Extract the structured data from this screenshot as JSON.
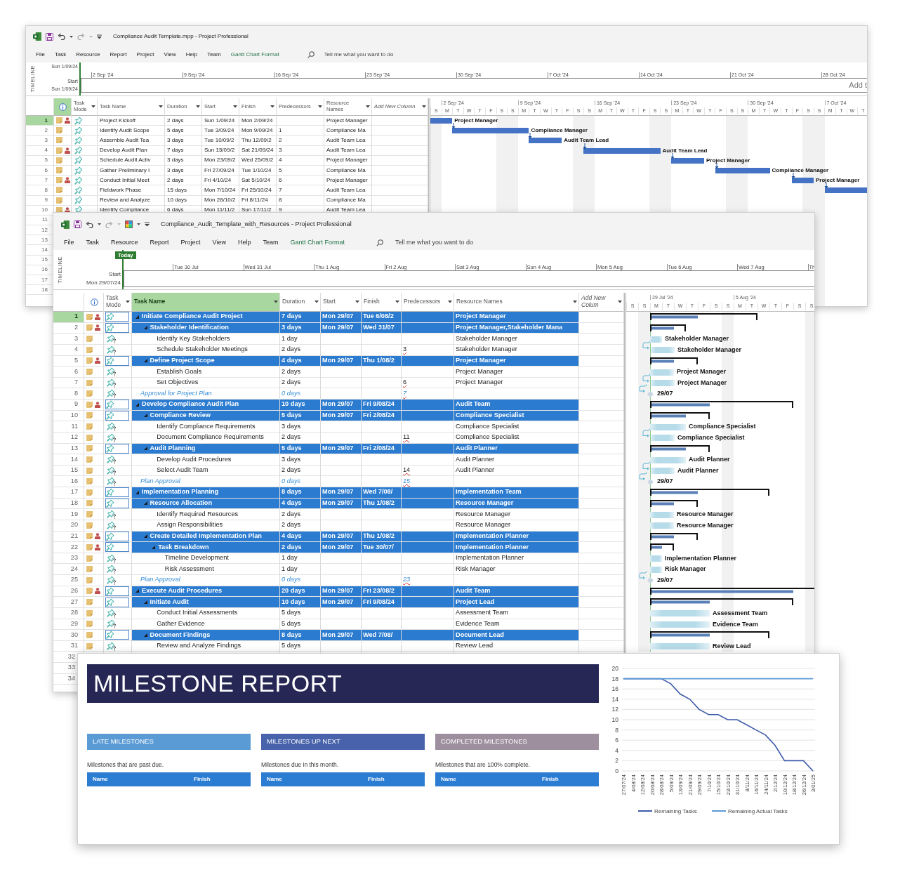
{
  "back_window": {
    "title": "Compliance Audit Template.mpp - Project Professional",
    "menu": [
      {
        "label": "File",
        "contextual": false
      },
      {
        "label": "Task",
        "contextual": false
      },
      {
        "label": "Resource",
        "contextual": false
      },
      {
        "label": "Report",
        "contextual": false
      },
      {
        "label": "Project",
        "contextual": false
      },
      {
        "label": "View",
        "contextual": false
      },
      {
        "label": "Help",
        "contextual": false
      },
      {
        "label": "Team",
        "contextual": false
      },
      {
        "label": "Gantt Chart Format",
        "contextual": true
      }
    ],
    "search": {
      "placeholder": "Tell me what you want to do"
    },
    "timeline": {
      "label": "TIMELINE",
      "top_date": "Sun 1/09/24",
      "start_label": "Start",
      "start_date": "Sun 1/09/24",
      "ticks": [
        "2 Sep '24",
        "9 Sep '24",
        "16 Sep '24",
        "23 Sep '24",
        "30 Sep '24",
        "7 Oct '24",
        "14 Oct '24",
        "21 Oct '24",
        "28 Oct '24"
      ],
      "hint": "Add t"
    },
    "indicator_header_selected": true,
    "columns": [
      {
        "label": "Task Mode",
        "selected": false
      },
      {
        "label": "Task Name",
        "selected": false
      },
      {
        "label": "Duration",
        "selected": false
      },
      {
        "label": "Start",
        "selected": false
      },
      {
        "label": "Finish",
        "selected": false
      },
      {
        "label": "Predecessors",
        "selected": false
      },
      {
        "label": "Resource Names",
        "selected": false
      },
      {
        "label": "Add New Column",
        "selected": false
      }
    ],
    "gantt": {
      "weeks": [
        "2 Sep '24",
        "9 Sep '24",
        "16 Sep '24",
        "23 Sep '24",
        "30 Sep '24",
        "7 Oct '24"
      ],
      "days": [
        "S",
        "M",
        "T",
        "W",
        "T",
        "F",
        "S",
        "S",
        "M",
        "T",
        "W",
        "T",
        "F",
        "S",
        "S",
        "M",
        "T",
        "W",
        "T",
        "F",
        "S",
        "S",
        "M",
        "T",
        "W",
        "T",
        "F",
        "S",
        "S",
        "M",
        "T",
        "W",
        "T",
        "F",
        "S",
        "S",
        "M",
        "T",
        "W",
        "T"
      ]
    },
    "rows": [
      {
        "number": "1",
        "selected": true,
        "resource_indicator": true,
        "name": "Project Kickoff",
        "duration": "2 days",
        "start": "Sun 1/09/24",
        "finish": "Mon 2/09/24",
        "resource": "Project Manager",
        "bar_label": "Project Manager"
      },
      {
        "number": "2",
        "selected": false,
        "resource_indicator": false,
        "name": "Identify Audit Scope",
        "duration": "5 days",
        "start": "Tue 3/09/24",
        "finish": "Mon 9/09/24",
        "predecessors": "1",
        "resource": "Compliance Ma",
        "bar_label": "Compliance Manager"
      },
      {
        "number": "3",
        "selected": false,
        "resource_indicator": false,
        "name": "Assemble Audit Tea",
        "duration": "3 days",
        "start": "Tue 10/09/2",
        "finish": "Thu 12/09/2",
        "predecessors": "2",
        "resource": "Audit Team Lea",
        "bar_label": "Audit Team Lead"
      },
      {
        "number": "4",
        "selected": false,
        "resource_indicator": true,
        "name": "Develop Audit Plan",
        "duration": "7 days",
        "start": "Sun 15/09/2",
        "finish": "Sat 21/09/24",
        "predecessors": "3",
        "resource": "Audit Team Lea",
        "bar_label": "Audit Team Lead"
      },
      {
        "number": "5",
        "selected": false,
        "resource_indicator": false,
        "name": "Schedule Audit Activ",
        "duration": "3 days",
        "start": "Mon 23/09/2",
        "finish": "Wed 25/09/2",
        "predecessors": "4",
        "resource": "Project Manager",
        "bar_label": "Project Manager"
      },
      {
        "number": "6",
        "selected": false,
        "resource_indicator": false,
        "name": "Gather Preliminary I",
        "duration": "3 days",
        "start": "Fri 27/09/24",
        "finish": "Tue 1/10/24",
        "predecessors": "5",
        "resource": "Compliance Ma",
        "bar_label": "Compliance Manager"
      },
      {
        "number": "7",
        "selected": false,
        "resource_indicator": true,
        "name": "Conduct Initial Meet",
        "duration": "2 days",
        "start": "Fri 4/10/24",
        "finish": "Sat 5/10/24",
        "predecessors": "6",
        "resource": "Project Manager",
        "bar_label": "Project Manager"
      },
      {
        "number": "8",
        "selected": false,
        "resource_indicator": false,
        "name": "Fieldwork Phase",
        "duration": "15 days",
        "start": "Mon 7/10/24",
        "finish": "Fri 25/10/24",
        "predecessors": "7",
        "resource": "Audit Team Lea"
      },
      {
        "number": "9",
        "selected": false,
        "resource_indicator": false,
        "name": "Review and Analyze",
        "duration": "10 days",
        "start": "Mon 28/10/2",
        "finish": "Fri 8/11/24",
        "predecessors": "8",
        "resource": "Compliance Ma"
      },
      {
        "number": "10",
        "selected": false,
        "resource_indicator": true,
        "name": "Identify Compliance",
        "duration": "6 days",
        "start": "Mon 11/11/2",
        "finish": "Sun 17/11/2",
        "predecessors": "9",
        "resource": "Audit Team Lea"
      }
    ],
    "more_row_numbers": [
      "11",
      "12",
      "13",
      "14",
      "15",
      "16",
      "17",
      "18"
    ]
  },
  "front_window": {
    "title": "Compliance_Audit_Template_with_Resources - Project Professional",
    "menu": [
      {
        "label": "File",
        "contextual": false
      },
      {
        "label": "Task",
        "contextual": false
      },
      {
        "label": "Resource",
        "contextual": false
      },
      {
        "label": "Report",
        "contextual": false
      },
      {
        "label": "Project",
        "contextual": false
      },
      {
        "label": "View",
        "contextual": false
      },
      {
        "label": "Help",
        "contextual": false
      },
      {
        "label": "Team",
        "contextual": false
      },
      {
        "label": "Gantt Chart Format",
        "contextual": true
      }
    ],
    "search": {
      "placeholder": "Tell me what you want to do"
    },
    "timeline": {
      "label": "TIMELINE",
      "today": "Today",
      "start_label": "Start",
      "start_date": "Mon 29/07/24",
      "ticks": [
        "Tue 30 Jul",
        "Wed 31 Jul",
        "Thu 1 Aug",
        "Fri 2 Aug",
        "Sat 3 Aug",
        "Sun 4 Aug",
        "Mon 5 Aug",
        "Tue 6 Aug",
        "Wed 7 Aug",
        "Th"
      ]
    },
    "columns": [
      {
        "label": "Task Mode",
        "selected": false
      },
      {
        "label": "Task Name",
        "selected": true
      },
      {
        "label": "Duration",
        "selected": false
      },
      {
        "label": "Start",
        "selected": false
      },
      {
        "label": "Finish",
        "selected": false
      },
      {
        "label": "Predecessors",
        "selected": false
      },
      {
        "label": "Resource Names",
        "selected": false
      },
      {
        "label": "Add New Colum",
        "selected": false
      }
    ],
    "gantt": {
      "weeks": [
        "29 Jul '24",
        "5 Aug '24"
      ],
      "days": [
        "S",
        "S",
        "M",
        "T",
        "W",
        "T",
        "F",
        "S",
        "S",
        "M",
        "T",
        "W",
        "T",
        "F",
        "S",
        "S"
      ]
    },
    "rows": [
      {
        "number": "1",
        "kind": "summary",
        "expanded": true,
        "selected": true,
        "resource_indicator": true,
        "name": "Initiate Compliance Audit Project",
        "duration": "7 days",
        "start": "Mon 29/07",
        "finish": "Tue 6/08/2",
        "resource": "Project Manager",
        "children": [
          {
            "number": "2",
            "kind": "summary",
            "expanded": true,
            "selected": false,
            "resource_indicator": true,
            "name": "Stakeholder Identification",
            "duration": "3 days",
            "start": "Mon 29/07",
            "finish": "Wed 31/07",
            "resource": "Project Manager,Stakeholder Mana",
            "children": [
              {
                "number": "3",
                "kind": "task",
                "selected": false,
                "resource_indicator": false,
                "name": "Identify Key Stakeholders",
                "duration": "1 day",
                "resource": "Stakeholder Manager",
                "bar_label": "Stakeholder Manager"
              },
              {
                "number": "4",
                "kind": "task",
                "selected": false,
                "resource_indicator": false,
                "name": "Schedule Stakeholder Meetings",
                "duration": "2 days",
                "predecessors": "3",
                "resource": "Stakeholder Manager",
                "bar_label": "Stakeholder Manager"
              }
            ]
          },
          {
            "number": "5",
            "kind": "summary",
            "expanded": true,
            "selected": false,
            "resource_indicator": true,
            "name": "Define Project Scope",
            "duration": "4 days",
            "start": "Mon 29/07",
            "finish": "Thu 1/08/2",
            "resource": "Project Manager",
            "children": [
              {
                "number": "6",
                "kind": "task",
                "selected": false,
                "resource_indicator": false,
                "name": "Establish Goals",
                "duration": "2 days",
                "resource": "Project Manager",
                "bar_label": "Project Manager"
              },
              {
                "number": "7",
                "kind": "task",
                "selected": false,
                "resource_indicator": false,
                "name": "Set Objectives",
                "duration": "2 days",
                "predecessors": "6",
                "resource": "Project Manager",
                "bar_label": "Project Manager"
              }
            ]
          }
        ]
      },
      {
        "number": "8",
        "kind": "milestone",
        "selected": false,
        "resource_indicator": false,
        "name": "Approval for Project Plan",
        "duration": "0 days",
        "predecessors": "7",
        "bar_label": "29/07"
      },
      {
        "number": "9",
        "kind": "summary",
        "expanded": true,
        "selected": false,
        "resource_indicator": true,
        "name": "Develop Compliance Audit Plan",
        "duration": "10 days",
        "start": "Mon 29/07",
        "finish": "Fri 9/08/24",
        "resource": "Audit Team",
        "children": [
          {
            "number": "10",
            "kind": "summary",
            "expanded": true,
            "selected": false,
            "resource_indicator": false,
            "name": "Compliance Review",
            "duration": "5 days",
            "start": "Mon 29/07",
            "finish": "Fri 2/08/24",
            "resource": "Compliance Specialist",
            "children": [
              {
                "number": "11",
                "kind": "task",
                "selected": false,
                "resource_indicator": false,
                "name": "Identify Compliance Requirements",
                "duration": "3 days",
                "resource": "Compliance Specialist",
                "bar_label": "Compliance Specialist"
              },
              {
                "number": "12",
                "kind": "task",
                "selected": false,
                "resource_indicator": false,
                "name": "Document Compliance Requirements",
                "duration": "2 days",
                "predecessors": "11",
                "resource": "Compliance Specialist",
                "bar_label": "Compliance Specialist"
              }
            ]
          },
          {
            "number": "13",
            "kind": "summary",
            "expanded": true,
            "selected": false,
            "resource_indicator": false,
            "name": "Audit Planning",
            "duration": "5 days",
            "start": "Mon 29/07",
            "finish": "Fri 2/08/24",
            "resource": "Audit Planner",
            "children": [
              {
                "number": "14",
                "kind": "task",
                "selected": false,
                "resource_indicator": false,
                "name": "Develop Audit Procedures",
                "duration": "3 days",
                "resource": "Audit Planner",
                "bar_label": "Audit Planner"
              },
              {
                "number": "15",
                "kind": "task",
                "selected": false,
                "resource_indicator": false,
                "name": "Select Audit Team",
                "duration": "2 days",
                "predecessors": "14",
                "resource": "Audit Planner",
                "bar_label": "Audit Planner"
              }
            ]
          }
        ]
      },
      {
        "number": "16",
        "kind": "milestone",
        "selected": false,
        "resource_indicator": false,
        "name": "Plan Approval",
        "duration": "0 days",
        "predecessors": "15",
        "bar_label": "29/07"
      },
      {
        "number": "17",
        "kind": "summary",
        "expanded": true,
        "selected": false,
        "resource_indicator": false,
        "name": "Implementation Planning",
        "duration": "8 days",
        "start": "Mon 29/07",
        "finish": "Wed 7/08/",
        "resource": "Implementation Team",
        "children": [
          {
            "number": "18",
            "kind": "summary",
            "expanded": true,
            "selected": false,
            "resource_indicator": false,
            "name": "Resource Allocation",
            "duration": "4 days",
            "start": "Mon 29/07",
            "finish": "Thu 1/08/2",
            "resource": "Resource Manager",
            "children": [
              {
                "number": "19",
                "kind": "task",
                "selected": false,
                "resource_indicator": false,
                "name": "Identify Required Resources",
                "duration": "2 days",
                "resource": "Resource Manager",
                "bar_label": "Resource Manager"
              },
              {
                "number": "20",
                "kind": "task",
                "selected": false,
                "resource_indicator": false,
                "name": "Assign Responsibilities",
                "duration": "2 days",
                "resource": "Resource Manager",
                "bar_label": "Resource Manager"
              }
            ]
          },
          {
            "number": "21",
            "kind": "summary",
            "expanded": true,
            "selected": false,
            "resource_indicator": true,
            "name": "Create Detailed Implementation Plan",
            "duration": "4 days",
            "start": "Mon 29/07",
            "finish": "Thu 1/08/2",
            "resource": "Implementation Planner",
            "children": [
              {
                "number": "22",
                "kind": "summary",
                "expanded": true,
                "selected": false,
                "resource_indicator": true,
                "name": "Task Breakdown",
                "duration": "2 days",
                "start": "Mon 29/07",
                "finish": "Tue 30/07/",
                "resource": "Implementation Planner",
                "children": [
                  {
                    "number": "23",
                    "kind": "task",
                    "selected": false,
                    "resource_indicator": false,
                    "name": "Timeline Development",
                    "duration": "1 day",
                    "resource": "Implementation Planner",
                    "bar_label": "Implementation Planner"
                  },
                  {
                    "number": "24",
                    "kind": "task",
                    "selected": false,
                    "resource_indicator": false,
                    "name": "Risk Assessment",
                    "duration": "1 day",
                    "resource": "Risk Manager",
                    "bar_label": "Risk Manager"
                  }
                ]
              }
            ]
          }
        ]
      },
      {
        "number": "25",
        "kind": "milestone",
        "selected": false,
        "resource_indicator": false,
        "name": "Plan Approval",
        "duration": "0 days",
        "predecessors": "23",
        "bar_label": "29/07"
      },
      {
        "number": "26",
        "kind": "summary",
        "expanded": true,
        "selected": false,
        "resource_indicator": true,
        "name": "Execute Audit Procedures",
        "duration": "20 days",
        "start": "Mon 29/07",
        "finish": "Fri 23/08/2",
        "resource": "Audit Team",
        "children": [
          {
            "number": "27",
            "kind": "summary",
            "expanded": true,
            "selected": false,
            "resource_indicator": false,
            "name": "Initiate Audit",
            "duration": "10 days",
            "start": "Mon 29/07",
            "finish": "Fri 9/08/24",
            "resource": "Project Lead",
            "children": [
              {
                "number": "28",
                "kind": "task",
                "selected": false,
                "resource_indicator": false,
                "name": "Conduct Initial Assessments",
                "duration": "5 days",
                "resource": "Assessment Team",
                "bar_label": "Assessment Team"
              },
              {
                "number": "29",
                "kind": "task",
                "selected": false,
                "resource_indicator": false,
                "name": "Gather Evidence",
                "duration": "5 days",
                "resource": "Evidence Team",
                "bar_label": "Evidence Team"
              }
            ]
          },
          {
            "number": "30",
            "kind": "summary",
            "expanded": true,
            "selected": false,
            "resource_indicator": false,
            "name": "Document Findings",
            "duration": "8 days",
            "start": "Mon 29/07",
            "finish": "Wed 7/08/",
            "resource": "Document Lead",
            "children": [
              {
                "number": "31",
                "kind": "task",
                "selected": false,
                "resource_indicator": false,
                "name": "Review and Analyze Findings",
                "duration": "5 days",
                "resource": "Review Lead",
                "bar_label": "Review Lead"
              }
            ]
          }
        ]
      }
    ],
    "more_row_numbers": [
      "32",
      "33",
      "34"
    ]
  },
  "milestone_report": {
    "title": "MILESTONE REPORT",
    "sections": [
      {
        "heading": "LATE MILESTONES",
        "color": "#5b9bd5",
        "description": "Milestones that are past due.",
        "columns": [
          "Name",
          "Finish"
        ]
      },
      {
        "heading": "MILESTONES UP NEXT",
        "color": "#4863ab",
        "description": "Milestones due in this month.",
        "columns": [
          "Name",
          "Finish"
        ]
      },
      {
        "heading": "COMPLETED MILESTONES",
        "color": "#9e8f9f",
        "description": "Milestones that are 100% complete.",
        "columns": [
          "Name",
          "Finish"
        ]
      }
    ],
    "chart_data": {
      "type": "line",
      "categories": [
        "27/07/24",
        "4/08/24",
        "12/08/24",
        "20/08/24",
        "28/08/24",
        "5/09/24",
        "13/09/24",
        "21/09/24",
        "29/09/24",
        "7/10/24",
        "15/10/24",
        "23/10/24",
        "31/10/24",
        "8/11/24",
        "16/11/24",
        "24/11/24",
        "2/12/24",
        "10/12/24",
        "18/12/24",
        "26/12/24",
        "3/01/25"
      ],
      "series": [
        {
          "name": "Remaining Tasks",
          "color": "#3d5ba9",
          "values": [
            18,
            18,
            18,
            18,
            18,
            17,
            15,
            14,
            12,
            11,
            11,
            10,
            10,
            9,
            8,
            7,
            5,
            2,
            2,
            2,
            0
          ]
        },
        {
          "name": "Remaining Actual Tasks",
          "color": "#5b9bd5",
          "values": [
            18,
            18,
            18,
            18,
            18,
            18,
            18,
            18,
            18,
            18,
            18,
            18,
            18,
            18,
            18,
            18,
            18,
            18,
            18,
            18,
            18
          ]
        }
      ],
      "ylim": [
        0,
        20
      ],
      "yticks": [
        {
          "value": 0,
          "label": "0"
        },
        {
          "value": 2,
          "label": "2"
        },
        {
          "value": 4,
          "label": "4"
        },
        {
          "value": 6,
          "label": "6"
        },
        {
          "value": 8,
          "label": "8"
        },
        {
          "value": 10,
          "label": "10"
        },
        {
          "value": 12,
          "label": "12"
        },
        {
          "value": 14,
          "label": "14"
        },
        {
          "value": 16,
          "label": "16"
        },
        {
          "value": 18,
          "label": "18"
        },
        {
          "value": 20,
          "label": "20"
        }
      ],
      "grid": true,
      "legend": "bottom"
    }
  }
}
